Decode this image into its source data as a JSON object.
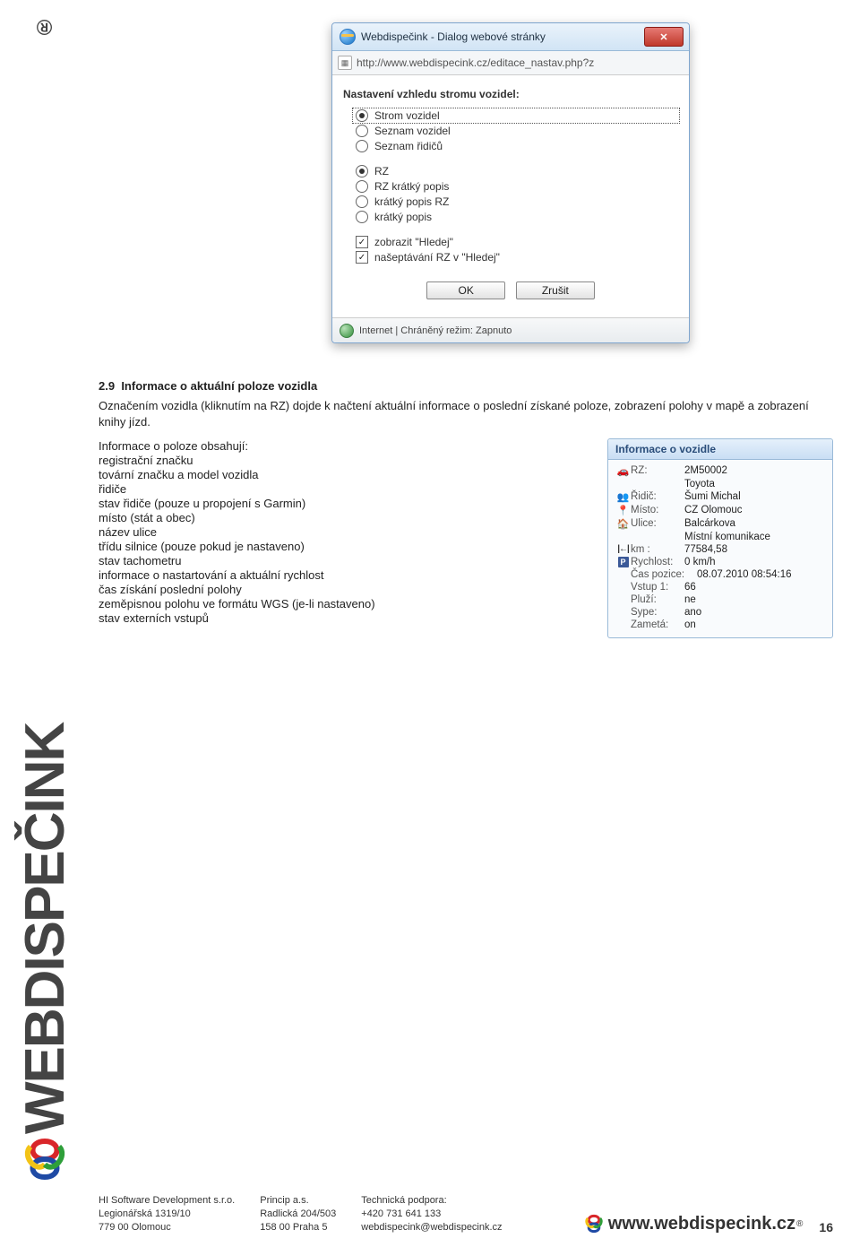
{
  "sidebar": {
    "brand": "WEBDISPEČINK",
    "reg": "®"
  },
  "dialog": {
    "title": "Webdispečink - Dialog webové stránky",
    "url": "http://www.webdispecink.cz/editace_nastav.php?z",
    "section_title": "Nastavení vzhledu stromu vozidel:",
    "group1": [
      {
        "label": "Strom vozidel",
        "selected": true,
        "focused": true
      },
      {
        "label": "Seznam vozidel",
        "selected": false
      },
      {
        "label": "Seznam řidičů",
        "selected": false
      }
    ],
    "group2": [
      {
        "label": "RZ",
        "selected": true
      },
      {
        "label": "RZ krátký popis",
        "selected": false
      },
      {
        "label": "krátký popis RZ",
        "selected": false
      },
      {
        "label": "krátký popis",
        "selected": false
      }
    ],
    "group3": [
      {
        "label": "zobrazit \"Hledej\"",
        "checked": true
      },
      {
        "label": "našeptávání RZ v \"Hledej\"",
        "checked": true
      }
    ],
    "buttons": {
      "ok": "OK",
      "cancel": "Zrušit"
    },
    "statusbar": "Internet | Chráněný režim: Zapnuto"
  },
  "section": {
    "heading_num": "2.9",
    "heading": "Informace o aktuální poloze vozidla",
    "para": "Označením vozidla (kliknutím na RZ) dojde k načtení aktuální informace o poslední získané poloze, zobrazení polohy v mapě a zobrazení knihy jízd.",
    "list_intro": "Informace o poloze obsahují:",
    "list": [
      "registrační značku",
      "tovární značku a model vozidla",
      "řidiče",
      "stav řidiče (pouze u propojení s Garmin)",
      "místo (stát a obec)",
      "název ulice",
      "třídu silnice (pouze pokud je nastaveno)",
      "stav tachometru",
      "informace o nastartování a aktuální rychlost",
      "čas získání poslední polohy",
      "zeměpisnou polohu ve formátu WGS (je-li nastaveno)",
      "stav externích vstupů"
    ]
  },
  "info_card": {
    "title": "Informace o vozidle",
    "rows": [
      {
        "icon": "car",
        "label": "RZ:",
        "value": "2M50002"
      },
      {
        "icon": "",
        "label": "",
        "value": "Toyota"
      },
      {
        "icon": "users",
        "label": "Řidič:",
        "value": "Šumi Michal"
      },
      {
        "icon": "pin",
        "label": "Místo:",
        "value": "CZ Olomouc"
      },
      {
        "icon": "home",
        "label": "Ulice:",
        "value": "Balcárkova"
      },
      {
        "icon": "",
        "label": "",
        "value": "Místní komunikace"
      },
      {
        "icon": "km",
        "label": "km :",
        "value": "77584,58"
      },
      {
        "icon": "park",
        "label": "Rychlost:",
        "value": "0 km/h"
      },
      {
        "icon": "",
        "label": "Čas pozice:",
        "value": "08.07.2010 08:54:16"
      },
      {
        "icon": "",
        "label": "Vstup 1:",
        "value": "66"
      },
      {
        "icon": "",
        "label": "Pluží:",
        "value": "ne"
      },
      {
        "icon": "",
        "label": "Sype:",
        "value": "ano"
      },
      {
        "icon": "",
        "label": "Zametá:",
        "value": "on"
      }
    ]
  },
  "footer": {
    "col1": [
      "HI Software Development s.r.o.",
      "Legionářská 1319/10",
      "779 00 Olomouc"
    ],
    "col2": [
      "Princip a.s.",
      "Radlická 204/503",
      "158 00 Praha 5"
    ],
    "col3": [
      "Technická podpora:",
      "+420 731 641 133",
      "webdispecink@webdispecink.cz"
    ],
    "brand": "www.webdispecink.cz",
    "page": "16"
  }
}
